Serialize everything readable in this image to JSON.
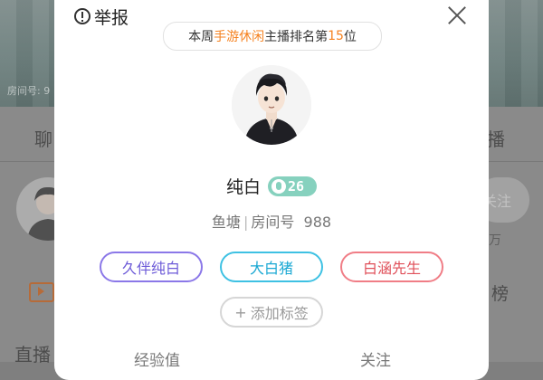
{
  "background": {
    "room_label": "房间号: 9",
    "chat_tab": "聊",
    "live_tab": "播",
    "follow_button": "关注",
    "fans": "万",
    "rank_label": "榜",
    "live_section": "直播"
  },
  "modal": {
    "report_label": "举报",
    "rank": {
      "prefix": "本周",
      "category": "手游休闲",
      "middle": "主播排名第",
      "position": "15",
      "suffix": "位"
    },
    "streamer": {
      "name": "纯白",
      "level": "26",
      "platform": "鱼塘",
      "room_label": "房间号",
      "room_number": "988"
    },
    "tags": [
      "久伴纯白",
      "大白猪",
      "白涵先生"
    ],
    "add_tag_label": "添加标签",
    "stats": {
      "left_label": "经验值",
      "right_label": "关注"
    }
  },
  "colors": {
    "accent_orange": "#f58220",
    "level_badge": "#86d1be",
    "tag_purple": "#8b78e8",
    "tag_blue": "#3ec1e3",
    "tag_red": "#f07d86"
  }
}
